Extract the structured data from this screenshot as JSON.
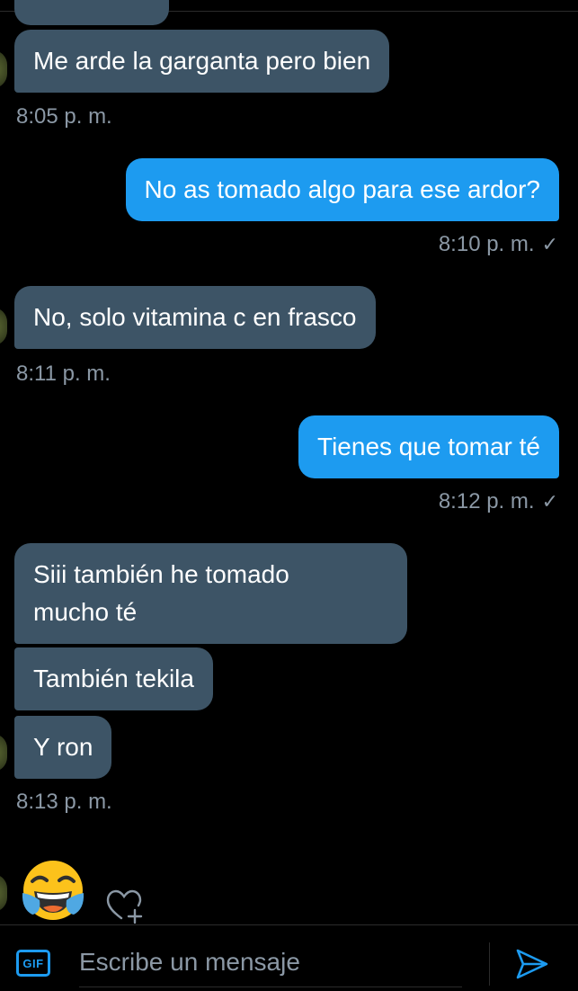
{
  "messages": [
    {
      "text": "Me arde la garganta pero bien",
      "time": "8:05 p. m."
    },
    {
      "text": "No as tomado algo para ese ardor?",
      "time": "8:10 p. m."
    },
    {
      "text": "No, solo vitamina c en frasco",
      "time": "8:11 p. m."
    },
    {
      "text": "Tienes que tomar té",
      "time": "8:12 p. m."
    },
    {
      "text_line1": "Siii también he tomado",
      "text_line2": "mucho té"
    },
    {
      "text": "También tekila"
    },
    {
      "text": "Y ron",
      "time": "8:13 p. m."
    }
  ],
  "read_mark": "✓",
  "reaction_emoji": "face-with-tears-of-joy",
  "composer": {
    "gif_label": "GIF",
    "placeholder": "Escribe un mensaje"
  },
  "colors": {
    "accent": "#1d9bf0",
    "incoming_bubble": "#3d5466",
    "timestamp": "#8b98a5",
    "background": "#000000"
  }
}
